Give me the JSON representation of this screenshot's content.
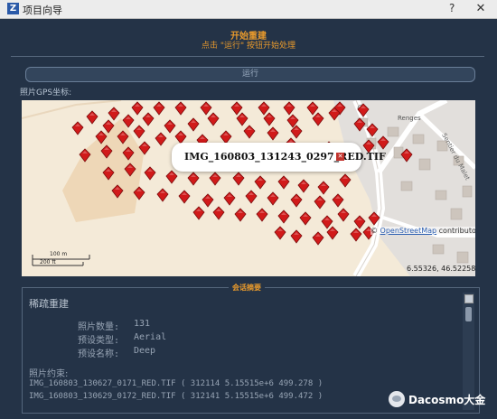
{
  "window": {
    "title": "项目向导",
    "help_label": "?",
    "close_label": "✕",
    "app_icon_letter": "Z"
  },
  "header": {
    "title": "开始重建",
    "subtitle": "点击 \"运行\" 按钮开始处理"
  },
  "run_button": {
    "label": "运行"
  },
  "map": {
    "label": "照片GPS坐标:",
    "popup_text": "IMG_160803_131243_0297_RED.TIF",
    "popup_close": "✕",
    "attribution_prefix": "© ",
    "attribution_link": "OpenStreetMap",
    "attribution_suffix": " contributors",
    "coordinates": "6.55326, 46.52258",
    "scale_m": "100 m",
    "scale_ft": "200 ft",
    "place_label": "Renges",
    "street_label": "Sentier du Malet",
    "info_marker": "i",
    "marker_color": "#d11a1a"
  },
  "summary": {
    "label": "会话摘要",
    "heading": "稀疏重建",
    "photo_count_label": "照片数量:",
    "photo_count": "131",
    "preset_type_label": "预设类型:",
    "preset_type": "Aerial",
    "preset_name_label": "预设名称:",
    "preset_name": "Deep",
    "constraints_label": "照片约束:",
    "constraints": [
      "IMG_160803_130627_0171_RED.TIF ( 312114 5.15515e+6 499.278 )",
      "IMG_160803_130629_0172_RED.TIF ( 312141 5.15515e+6 499.472 )"
    ]
  },
  "watermark": {
    "text": "Dacosmo大金"
  }
}
